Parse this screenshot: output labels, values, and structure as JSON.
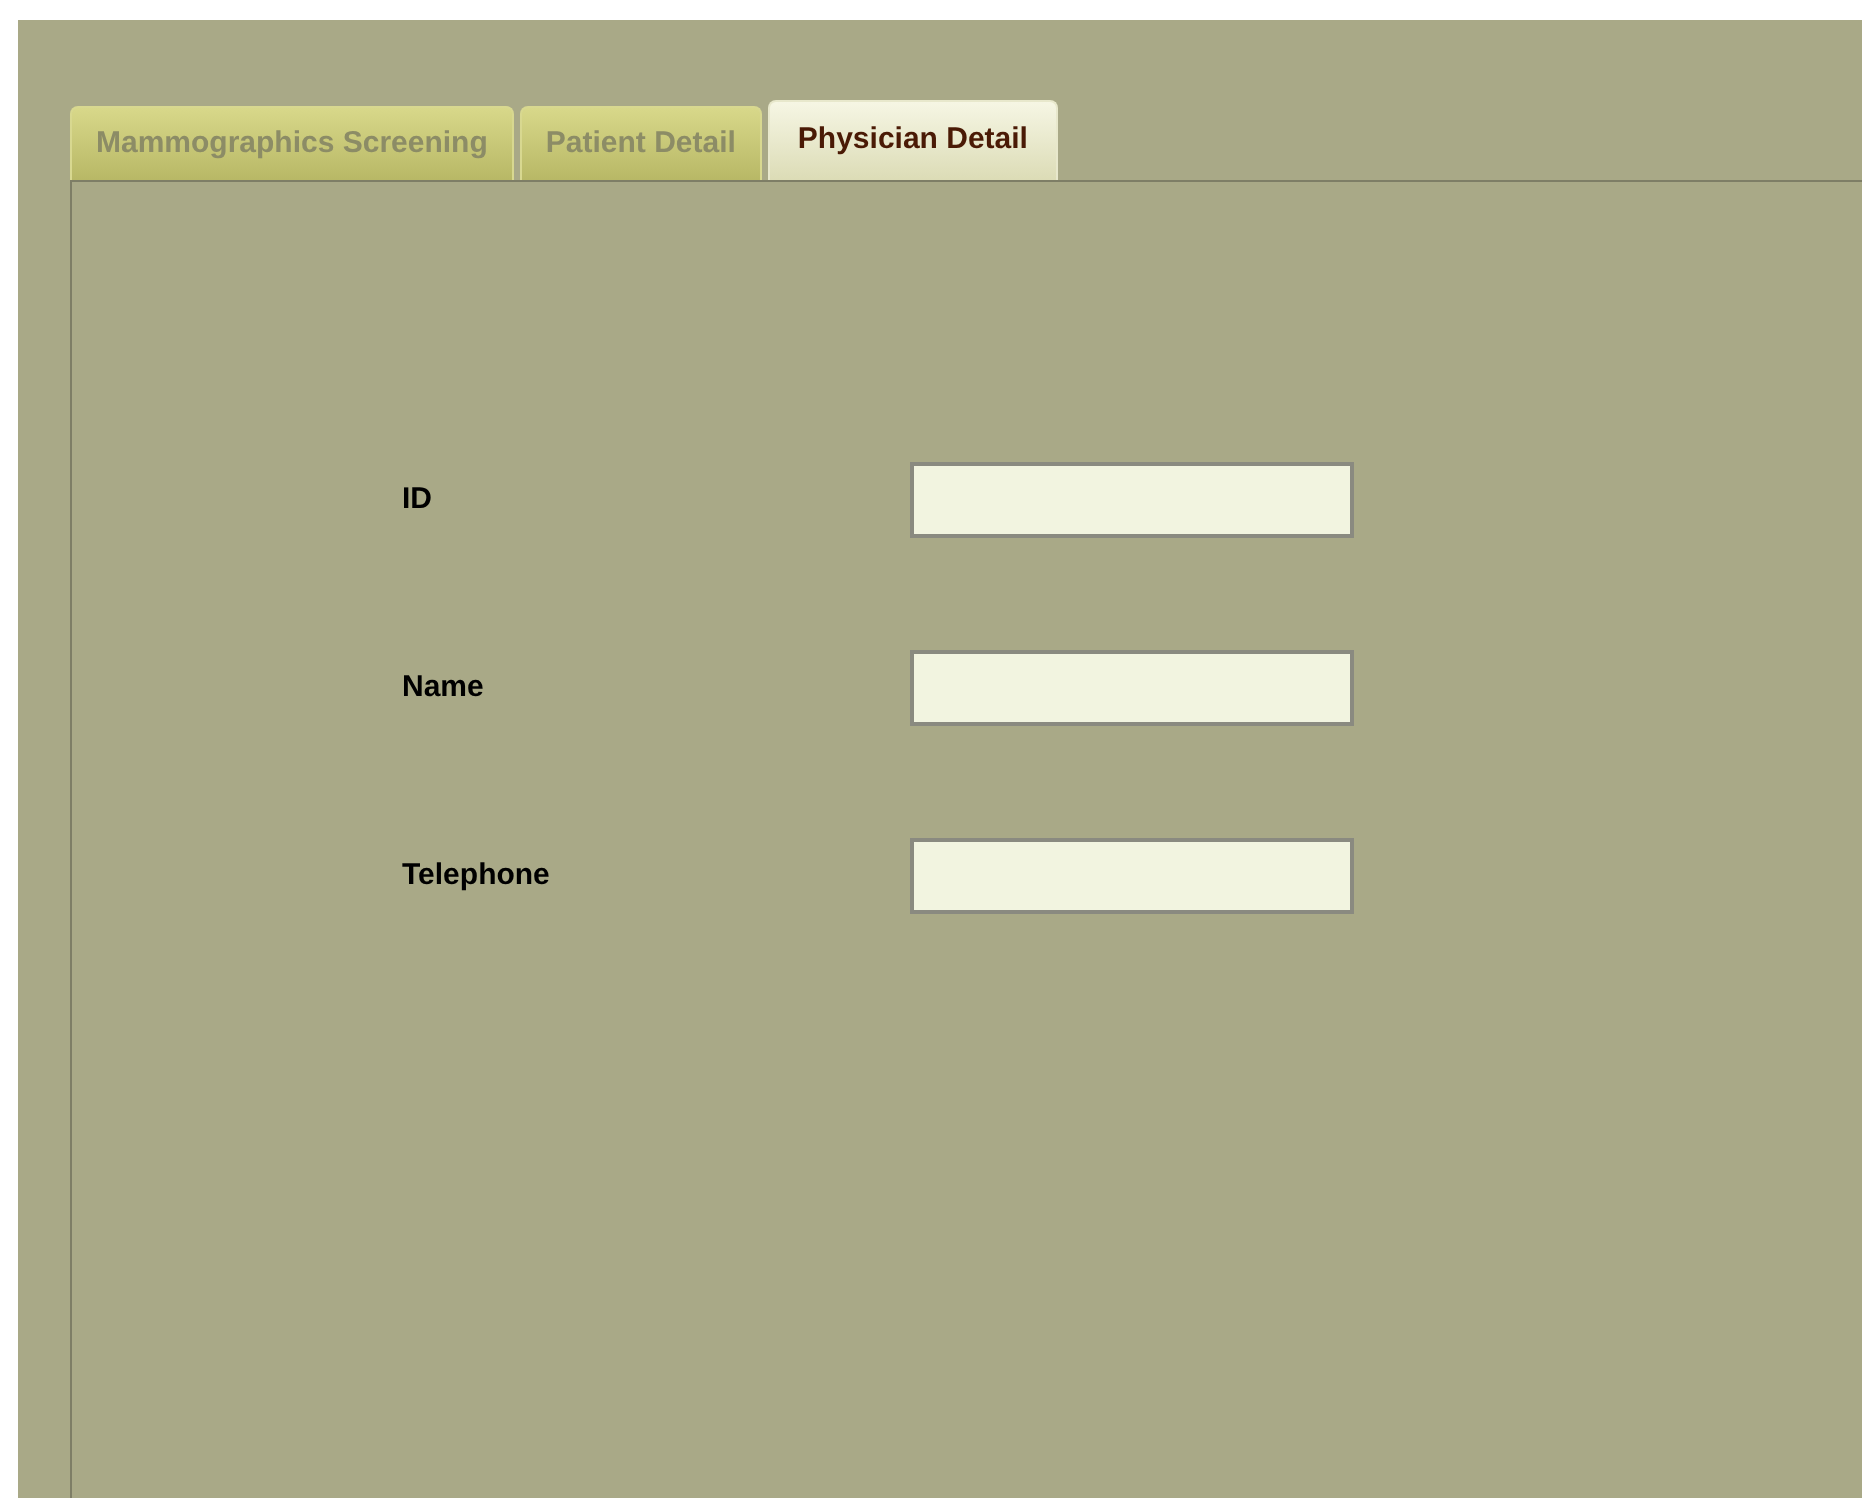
{
  "tabs": [
    {
      "label": "Mammographics Screening",
      "selected": false
    },
    {
      "label": "Patient Detail",
      "selected": false
    },
    {
      "label": "Physician Detail",
      "selected": true
    }
  ],
  "form": {
    "fields": [
      {
        "label": "ID"
      },
      {
        "label": "Name"
      },
      {
        "label": "Telephone"
      }
    ]
  }
}
